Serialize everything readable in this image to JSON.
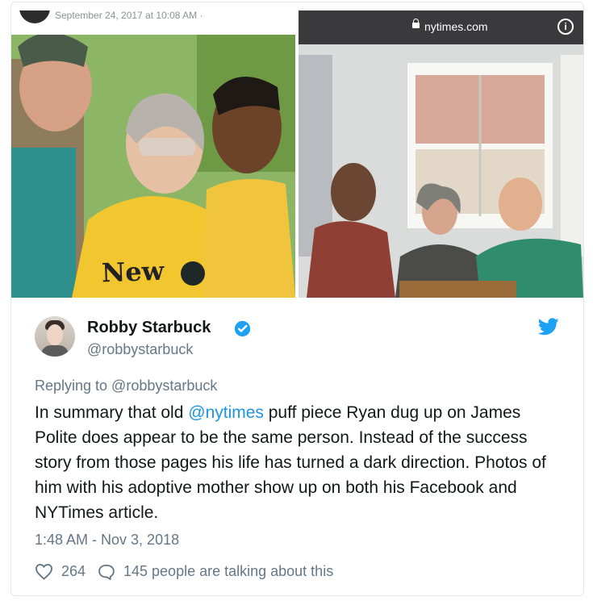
{
  "embedded_post": {
    "date": "September 24, 2017 at 10:08 AM · "
  },
  "browser": {
    "url": "nytimes.com"
  },
  "tweet": {
    "name": "Robby Starbuck",
    "handle": "@robbystarbuck",
    "replying_to": "Replying to @robbystarbuck",
    "text_before_mention": "In summary that old ",
    "mention": "@nytimes",
    "text_after_mention": " puff piece Ryan dug up on James Polite does appear to be the same person. Instead of the success story from those pages his life has turned a dark direction. Photos of him with his adoptive mother show up on both his Facebook and NYTimes article.",
    "timestamp": "1:48 AM - Nov 3, 2018",
    "likes": "264",
    "talking": "145 people are talking about this"
  },
  "shirt_text": "New",
  "colors": {
    "twitter_blue": "#1da1f2",
    "link_blue": "#1b95e0",
    "secondary_text": "#657786",
    "heart_outline": "#657786"
  },
  "icons": [
    "lock-icon",
    "info-icon",
    "verified-icon",
    "twitter-bird-icon",
    "heart-icon",
    "reply-icon"
  ]
}
